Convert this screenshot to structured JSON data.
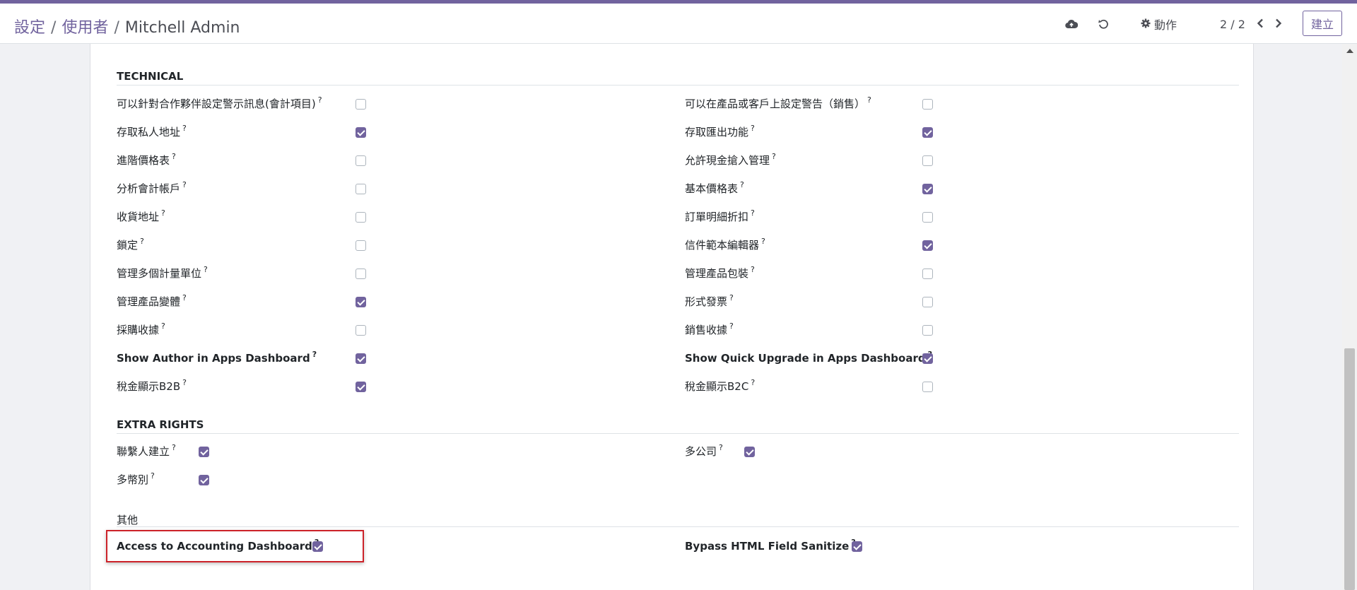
{
  "breadcrumb": {
    "item1": "設定",
    "sep": "/",
    "item2": "使用者",
    "current": "Mitchell Admin"
  },
  "toolbar": {
    "save_icon": "cloud-upload-icon",
    "discard_icon": "undo-icon",
    "action_label": "動作",
    "pager": "2 / 2",
    "create_label": "建立"
  },
  "sections": {
    "technical": {
      "title": "TECHNICAL",
      "left": [
        {
          "label": "可以針對合作夥伴設定警示訊息(會計項目)",
          "checked": false
        },
        {
          "label": "存取私人地址",
          "checked": true
        },
        {
          "label": "進階價格表",
          "checked": false
        },
        {
          "label": "分析會計帳戶",
          "checked": false
        },
        {
          "label": "收貨地址",
          "checked": false
        },
        {
          "label": "鎖定",
          "checked": false
        },
        {
          "label": "管理多個計量單位",
          "checked": false
        },
        {
          "label": "管理產品變體",
          "checked": true
        },
        {
          "label": "採購收據",
          "checked": false
        },
        {
          "label": "Show Author in Apps Dashboard",
          "checked": true,
          "bold": true
        },
        {
          "label": "稅金顯示B2B",
          "checked": true
        }
      ],
      "right": [
        {
          "label": "可以在產品或客戶上設定警告（銷售）",
          "checked": false
        },
        {
          "label": "存取匯出功能",
          "checked": true
        },
        {
          "label": "允許現金搶入管理",
          "checked": false
        },
        {
          "label": "基本價格表",
          "checked": true
        },
        {
          "label": "訂單明細折扣",
          "checked": false
        },
        {
          "label": "信件範本編輯器",
          "checked": true
        },
        {
          "label": "管理產品包裝",
          "checked": false
        },
        {
          "label": "形式發票",
          "checked": false
        },
        {
          "label": "銷售收據",
          "checked": false
        },
        {
          "label": "Show Quick Upgrade in Apps Dashboard",
          "checked": true,
          "bold": true
        },
        {
          "label": "稅金顯示B2C",
          "checked": false
        }
      ]
    },
    "extra_rights": {
      "title": "EXTRA RIGHTS",
      "left": [
        {
          "label": "聯繫人建立",
          "checked": true
        },
        {
          "label": "多幣別",
          "checked": true
        }
      ],
      "right": [
        {
          "label": "多公司",
          "checked": true
        }
      ]
    },
    "other": {
      "title": "其他",
      "left": [
        {
          "label": "Access to Accounting Dashboard",
          "checked": true,
          "bold": true
        }
      ],
      "right": [
        {
          "label": "Bypass HTML Field Sanitize",
          "checked": true,
          "bold": true
        }
      ]
    }
  },
  "help_marker": "?",
  "colors": {
    "accent": "#71639e",
    "highlight": "#cc2229"
  }
}
